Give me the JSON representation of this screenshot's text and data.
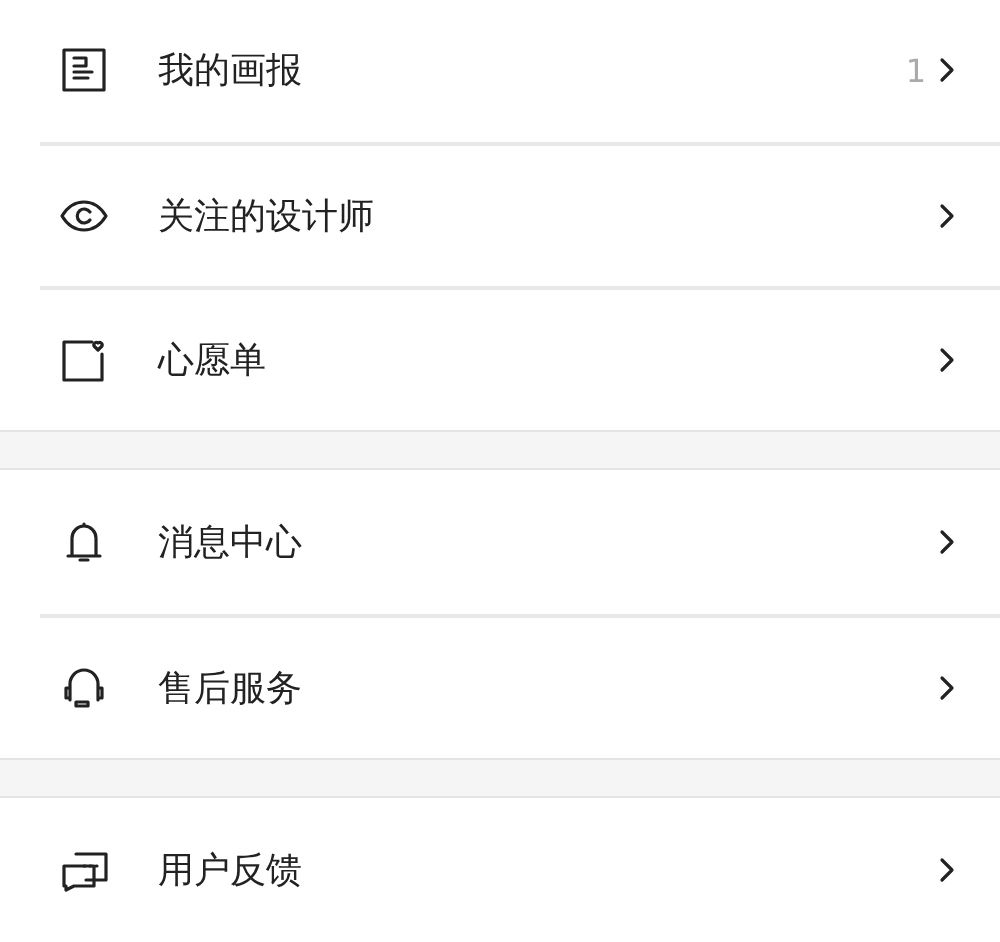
{
  "groups": [
    {
      "items": [
        {
          "label": "我的画报",
          "count": "1"
        },
        {
          "label": "关注的设计师"
        },
        {
          "label": "心愿单"
        }
      ]
    },
    {
      "items": [
        {
          "label": "消息中心"
        },
        {
          "label": "售后服务"
        }
      ]
    },
    {
      "items": [
        {
          "label": "用户反馈"
        }
      ]
    }
  ]
}
